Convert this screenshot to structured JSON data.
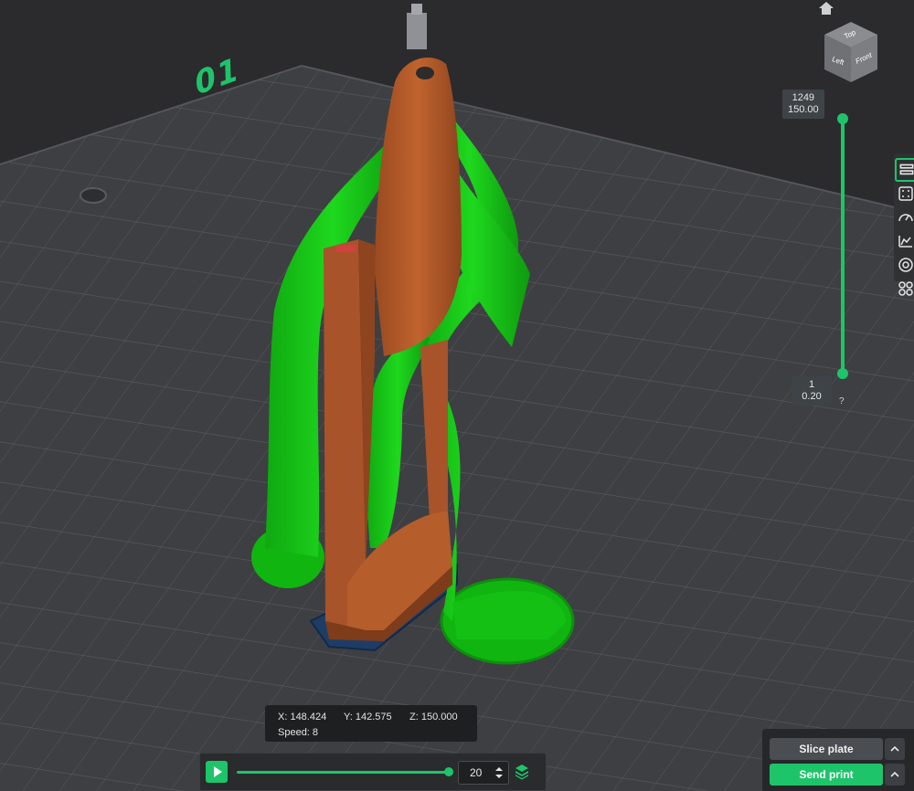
{
  "plate": {
    "label": "01"
  },
  "navcube": {
    "top": "Top",
    "left": "Left",
    "front": "Front"
  },
  "layer_slider": {
    "top_layer": "1249",
    "top_height": "150.00",
    "bottom_layer": "1",
    "bottom_height": "0.20",
    "help": "?"
  },
  "readout": {
    "x": "X: 148.424",
    "y": "Y: 142.575",
    "z": "Z: 150.000",
    "speed": "Speed: 8"
  },
  "playback": {
    "speed_value": "20",
    "progress": 1.0
  },
  "actions": {
    "slice_label": "Slice plate",
    "send_label": "Send print"
  },
  "colors": {
    "accent": "#1ec46a",
    "support": "#17c617",
    "model": "#b35a2a",
    "raft": "#1e3d66",
    "background": "#2b2b2d"
  },
  "icons": {
    "home": "home-icon",
    "toolbar": [
      "layer-view-icon",
      "grid-view-icon",
      "speed-gauge-icon",
      "chart-icon",
      "target-icon",
      "tool-palette-icon"
    ]
  }
}
